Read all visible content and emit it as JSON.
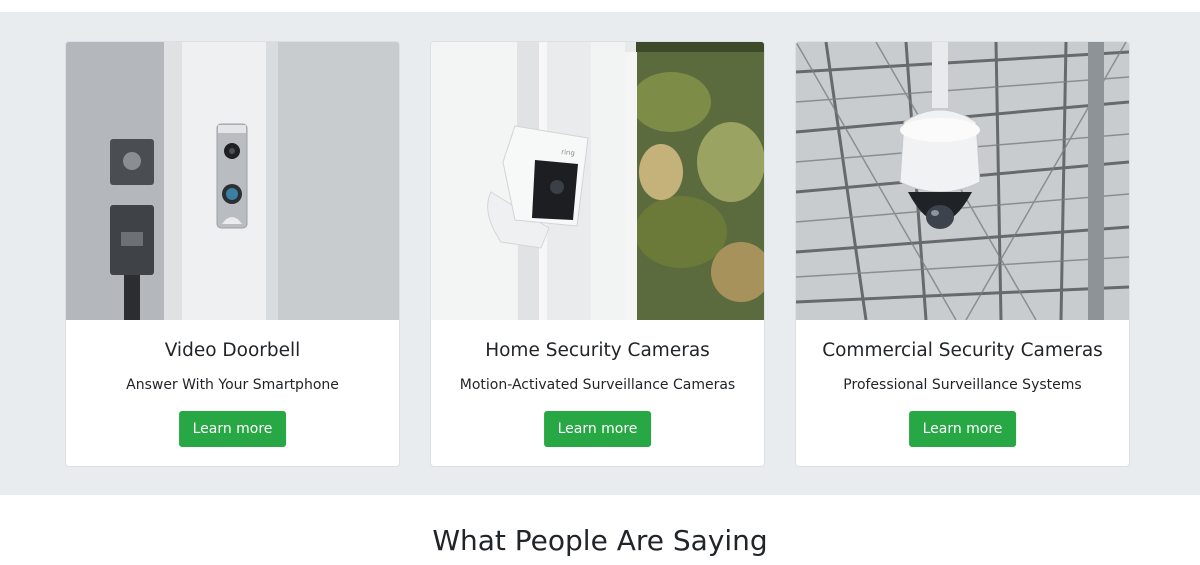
{
  "colors": {
    "band_background": "#e9ecef",
    "card_background": "#ffffff",
    "button_green": "#28a745",
    "text_dark": "#212529"
  },
  "products": [
    {
      "title": "Video Doorbell",
      "subtitle": "Answer With Your Smartphone",
      "button_label": "Learn more",
      "image": "video-doorbell-photo"
    },
    {
      "title": "Home Security Cameras",
      "subtitle": "Motion-Activated Surveillance Cameras",
      "button_label": "Learn more",
      "image": "home-security-camera-photo",
      "image_brand": "ring"
    },
    {
      "title": "Commercial Security Cameras",
      "subtitle": "Professional Surveillance Systems",
      "button_label": "Learn more",
      "image": "dome-security-camera-photo"
    }
  ],
  "testimonials": {
    "heading": "What People Are Saying"
  }
}
